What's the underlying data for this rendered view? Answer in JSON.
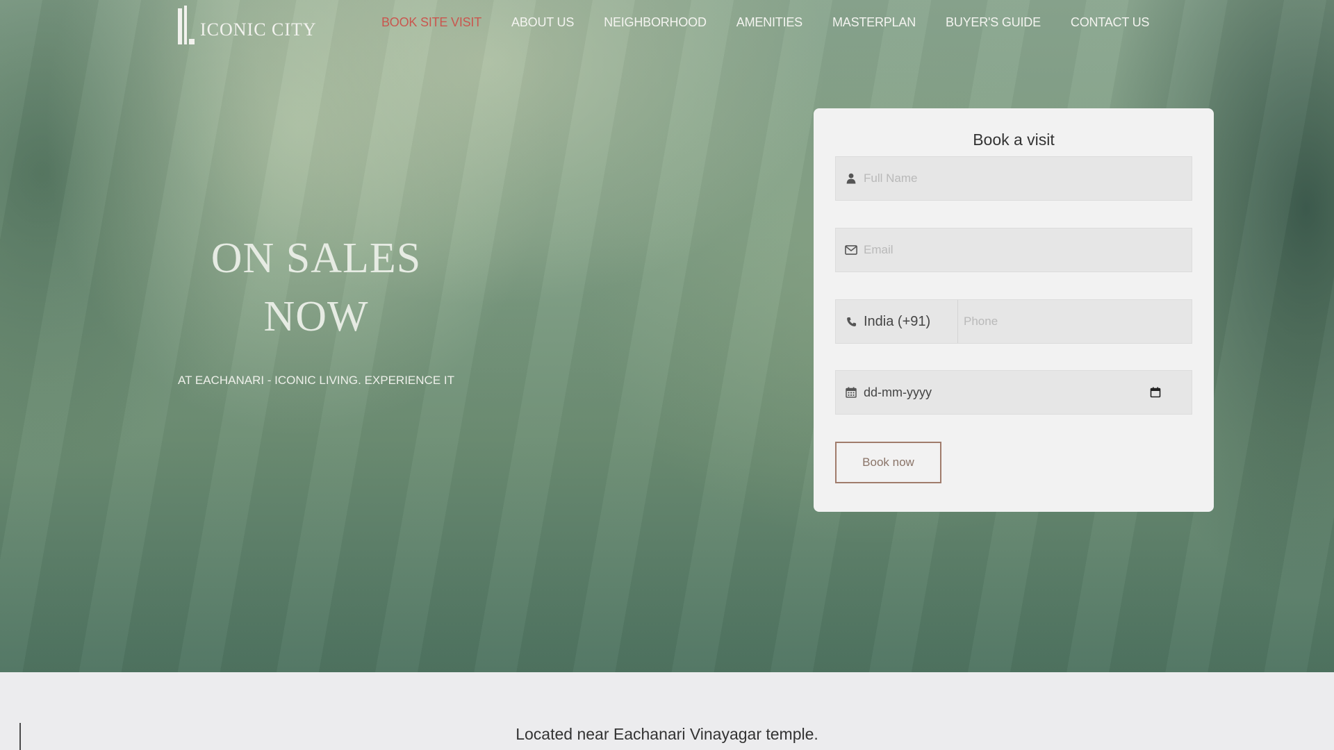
{
  "brand": {
    "logo_text": "ICONIC CITY"
  },
  "nav": {
    "items": [
      {
        "label": "BOOK SITE VISIT",
        "active": true
      },
      {
        "label": "ABOUT US"
      },
      {
        "label": "NEIGHBORHOOD"
      },
      {
        "label": "AMENITIES"
      },
      {
        "label": "MASTERPLAN"
      },
      {
        "label": "BUYER'S GUIDE"
      },
      {
        "label": "CONTACT US"
      }
    ],
    "active_color": "#c9564e"
  },
  "hero": {
    "headline_line1": "ON SALES",
    "headline_line2": "NOW",
    "tagline": "AT EACHANARI - ICONIC LIVING. EXPERIENCE IT"
  },
  "form": {
    "title": "Book a visit",
    "full_name": {
      "placeholder": "Full Name",
      "icon": "user-icon"
    },
    "email": {
      "placeholder": "Email",
      "icon": "envelope-icon"
    },
    "phone": {
      "country": "India (+91)",
      "placeholder": "Phone",
      "icon": "phone-icon"
    },
    "date": {
      "placeholder": "dd-mm-yyyy",
      "icon": "calendar-icon"
    },
    "submit_label": "Book now"
  },
  "below": {
    "location_text": "Located near Eachanari Vinayagar temple."
  }
}
